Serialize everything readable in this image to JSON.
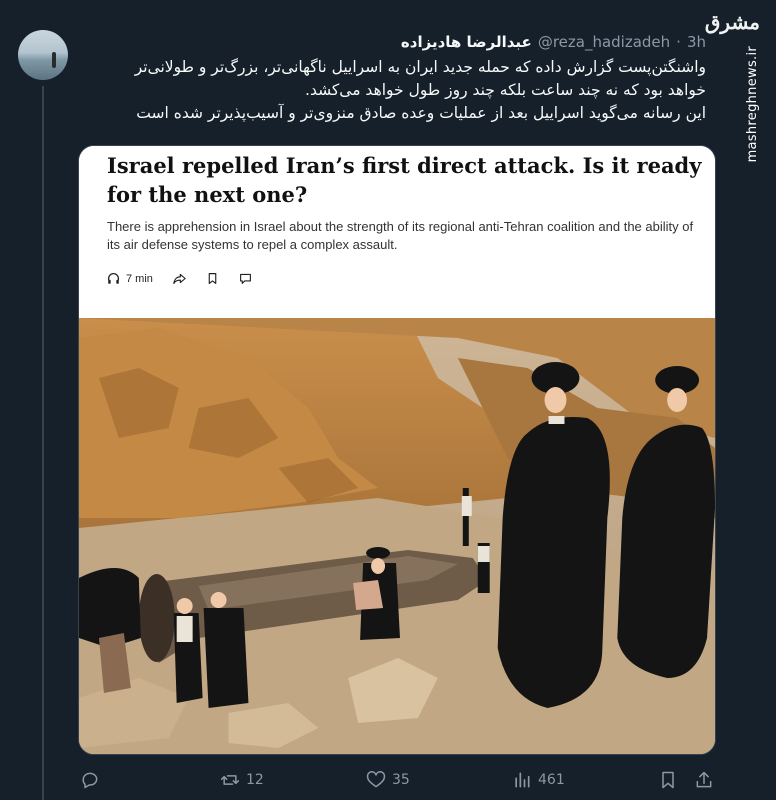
{
  "tweet": {
    "display_name": "عبدالرضا هادیزاده",
    "handle": "@reza_hadizadeh",
    "separator": "·",
    "time": "3h",
    "text_lines": [
      "واشنگتن‌پست گزارش داده که حمله جدید ایران به اسراییل ناگهانی‌تر، بزرگ‌تر و طولانی‌تر",
      "خواهد بود که نه چند ساعت بلکه چند روز طول خواهد می‌کشد.",
      "این رسانه می‌گوید اسراییل بعد از عملیات وعده صادق منزوی‌تر و آسیب‌پذیرتر شده است"
    ]
  },
  "watermark": {
    "logo": "مشرق",
    "url": "mashreghnews.ir"
  },
  "article": {
    "headline": "Israel repelled Iran’s first direct attack. Is it ready for the next one?",
    "dek": "There is apprehension in Israel about the strength of its regional anti-Tehran coalition and the ability of its air defense systems to repel a complex assault.",
    "listen_time": "7 min"
  },
  "metrics": {
    "replies": "",
    "retweets": "12",
    "likes": "35",
    "views": "461"
  },
  "icons": {
    "reply": "reply-icon",
    "retweet": "retweet-icon",
    "like": "heart-icon",
    "views": "views-icon",
    "bookmark": "bookmark-icon",
    "share": "share-icon"
  },
  "colors": {
    "background": "#15202b",
    "text_primary": "#f7f9f9",
    "text_secondary": "#8b98a5",
    "border": "#38444d"
  }
}
